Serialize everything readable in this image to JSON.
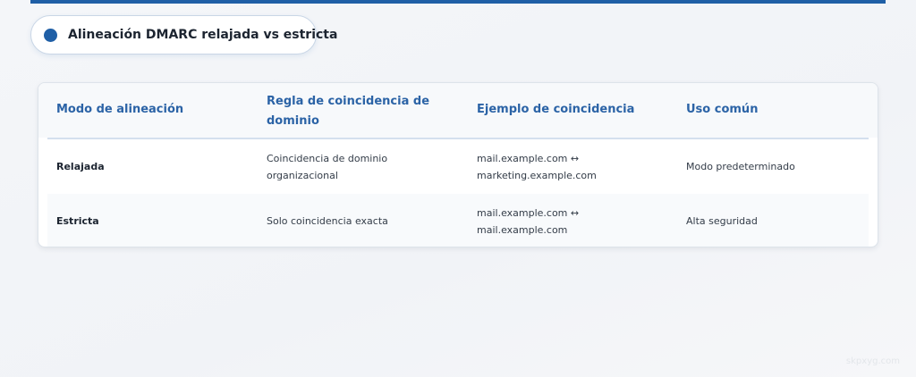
{
  "title": "Alineación DMARC relajada vs estricta",
  "table": {
    "headers": [
      "Modo de alineación",
      "Regla de coincidencia de dominio",
      "Ejemplo de coincidencia",
      "Uso común"
    ],
    "rows": [
      {
        "mode": "Relajada",
        "rule": "Coincidencia de dominio organizacional",
        "example": "mail.example.com ↔ marketing.example.com",
        "usage": "Modo predeterminado"
      },
      {
        "mode": "Estricta",
        "rule": "Solo coincidencia exacta",
        "example": "mail.example.com ↔ mail.example.com",
        "usage": "Alta seguridad"
      }
    ]
  },
  "watermark": "skpxyg.com",
  "colors": {
    "accent": "#1f5fa6",
    "header_text": "#2b63a6"
  }
}
